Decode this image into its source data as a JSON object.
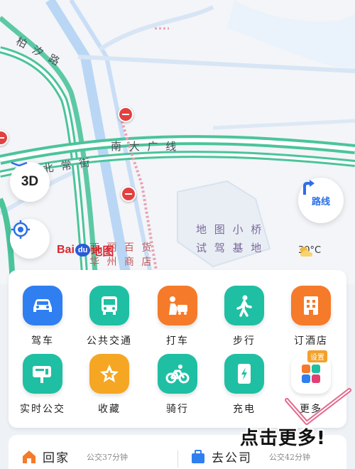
{
  "map": {
    "roads": {
      "road1": "柏 汐 路",
      "road2": "南 大 广 线",
      "road3": "北 常 街"
    },
    "poi": {
      "line1": "地 图 小 桥",
      "line2": "试 驾 基 地"
    },
    "store": {
      "line1": "西 丽 百 货",
      "line2": "华 州 商 店"
    },
    "baidu": {
      "left": "Bai",
      "mid": "du",
      "right": "地图"
    },
    "buttons": {
      "threed": "3D",
      "route": "路线"
    },
    "weather": {
      "temp": "30°C",
      "icon": "partly-cloudy-icon"
    }
  },
  "shortcuts": [
    {
      "label": "驾车",
      "icon": "car-icon",
      "color": "#2f7ff0"
    },
    {
      "label": "公共交通",
      "icon": "bus-icon",
      "color": "#1fbfa3"
    },
    {
      "label": "打车",
      "icon": "taxi-icon",
      "color": "#f57a2a"
    },
    {
      "label": "步行",
      "icon": "walk-icon",
      "color": "#1fbfa3"
    },
    {
      "label": "订酒店",
      "icon": "hotel-icon",
      "color": "#f57a2a"
    },
    {
      "label": "实时公交",
      "icon": "realtime-bus-icon",
      "color": "#1fbfa3"
    },
    {
      "label": "收藏",
      "icon": "star-icon",
      "color": "#f5a623"
    },
    {
      "label": "骑行",
      "icon": "bike-icon",
      "color": "#1fbfa3"
    },
    {
      "label": "充电",
      "icon": "charge-icon",
      "color": "#1fbfa3"
    },
    {
      "label": "更多",
      "icon": "more-apps-icon",
      "badge": "设置"
    }
  ],
  "bottom": {
    "home": {
      "name": "回家",
      "time": "公交37分钟",
      "icon": "home-icon",
      "color": "#f57a2a"
    },
    "work": {
      "name": "去公司",
      "time": "公交42分钟",
      "icon": "briefcase-icon",
      "color": "#2f7ff0"
    }
  },
  "overlay": "点击更多!"
}
